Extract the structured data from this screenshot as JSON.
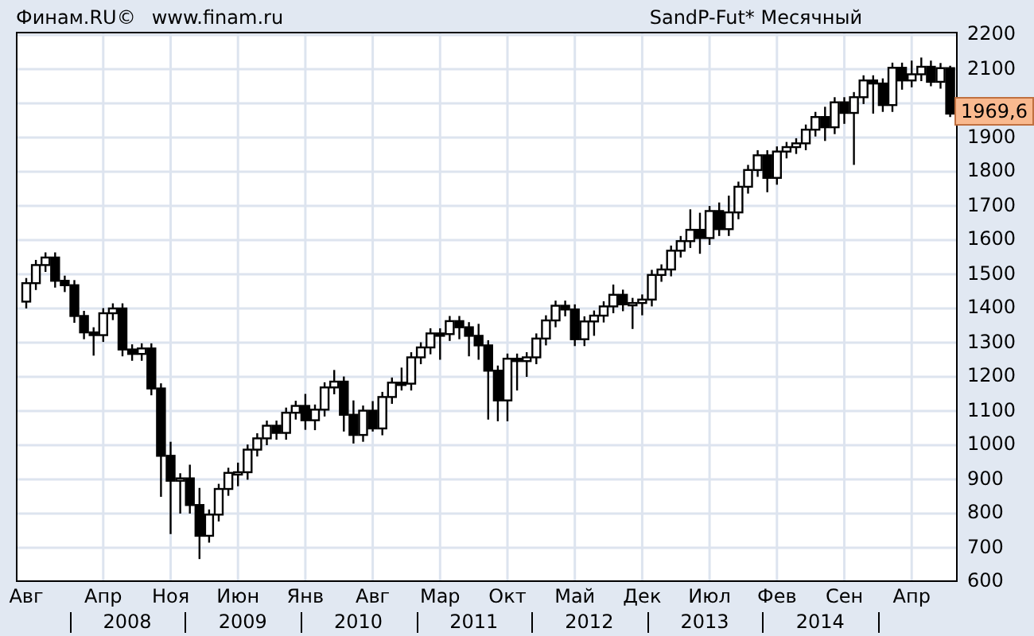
{
  "header": {
    "copyright": "Финам.RU©",
    "site": "www.finam.ru",
    "instrument": "SandP-Fut* Месячный"
  },
  "chart": {
    "chart_data": {
      "type": "candlestick",
      "categories": [
        "Авг",
        null,
        null,
        null,
        null,
        null,
        null,
        null,
        "Апр",
        null,
        null,
        null,
        null,
        null,
        null,
        "Ноя",
        null,
        null,
        null,
        null,
        null,
        null,
        "Июн",
        null,
        null,
        null,
        null,
        null,
        null,
        "Янв",
        null,
        null,
        null,
        null,
        null,
        null,
        "Авг",
        null,
        null,
        null,
        null,
        null,
        null,
        "Мар",
        null,
        null,
        null,
        null,
        null,
        null,
        "Окт",
        null,
        null,
        null,
        null,
        null,
        null,
        "Май",
        null,
        null,
        null,
        null,
        null,
        null,
        "Дек",
        null,
        null,
        null,
        null,
        null,
        null,
        "Июл",
        null,
        null,
        null,
        null,
        null,
        null,
        "Фев",
        null,
        null,
        null,
        null,
        null,
        null,
        "Сен",
        null,
        null,
        null,
        null,
        null,
        null,
        "Апр",
        null,
        null,
        null,
        null
      ],
      "ohlc": [
        [
          1420,
          1489,
          1400,
          1474
        ],
        [
          1474,
          1542,
          1454,
          1527
        ],
        [
          1527,
          1564,
          1507,
          1549
        ],
        [
          1549,
          1564,
          1461,
          1481
        ],
        [
          1481,
          1496,
          1448,
          1468
        ],
        [
          1468,
          1483,
          1358,
          1378
        ],
        [
          1378,
          1393,
          1310,
          1330
        ],
        [
          1330,
          1345,
          1262,
          1322
        ],
        [
          1322,
          1401,
          1302,
          1386
        ],
        [
          1386,
          1415,
          1366,
          1400
        ],
        [
          1400,
          1415,
          1260,
          1280
        ],
        [
          1280,
          1295,
          1247,
          1267
        ],
        [
          1267,
          1298,
          1247,
          1283
        ],
        [
          1283,
          1298,
          1146,
          1166
        ],
        [
          1166,
          1181,
          849,
          969
        ],
        [
          969,
          1010,
          740,
          896
        ],
        [
          896,
          918,
          800,
          903
        ],
        [
          903,
          943,
          800,
          825
        ],
        [
          825,
          875,
          667,
          735
        ],
        [
          735,
          812,
          715,
          797
        ],
        [
          797,
          887,
          777,
          872
        ],
        [
          872,
          934,
          852,
          919
        ],
        [
          919,
          949,
          880,
          921
        ],
        [
          921,
          1002,
          899,
          987
        ],
        [
          987,
          1035,
          967,
          1020
        ],
        [
          1020,
          1072,
          1000,
          1057
        ],
        [
          1057,
          1072,
          1016,
          1036
        ],
        [
          1036,
          1110,
          1016,
          1095
        ],
        [
          1095,
          1130,
          1075,
          1115
        ],
        [
          1115,
          1150,
          1045,
          1073
        ],
        [
          1073,
          1119,
          1044,
          1104
        ],
        [
          1104,
          1184,
          1084,
          1169
        ],
        [
          1169,
          1220,
          1149,
          1186
        ],
        [
          1186,
          1201,
          1040,
          1089
        ],
        [
          1089,
          1131,
          1005,
          1030
        ],
        [
          1030,
          1116,
          1010,
          1101
        ],
        [
          1101,
          1129,
          1040,
          1049
        ],
        [
          1049,
          1156,
          1029,
          1141
        ],
        [
          1141,
          1198,
          1121,
          1183
        ],
        [
          1183,
          1227,
          1160,
          1180
        ],
        [
          1180,
          1272,
          1160,
          1257
        ],
        [
          1257,
          1301,
          1237,
          1286
        ],
        [
          1286,
          1342,
          1266,
          1327
        ],
        [
          1327,
          1342,
          1250,
          1325
        ],
        [
          1325,
          1378,
          1305,
          1363
        ],
        [
          1363,
          1378,
          1310,
          1345
        ],
        [
          1345,
          1360,
          1260,
          1320
        ],
        [
          1320,
          1355,
          1250,
          1292
        ],
        [
          1292,
          1307,
          1075,
          1218
        ],
        [
          1218,
          1233,
          1070,
          1131
        ],
        [
          1131,
          1268,
          1070,
          1253
        ],
        [
          1253,
          1268,
          1160,
          1246
        ],
        [
          1246,
          1272,
          1200,
          1257
        ],
        [
          1257,
          1327,
          1237,
          1312
        ],
        [
          1312,
          1380,
          1292,
          1365
        ],
        [
          1365,
          1423,
          1345,
          1408
        ],
        [
          1408,
          1423,
          1377,
          1397
        ],
        [
          1397,
          1412,
          1290,
          1310
        ],
        [
          1310,
          1377,
          1290,
          1362
        ],
        [
          1362,
          1394,
          1320,
          1379
        ],
        [
          1379,
          1421,
          1359,
          1406
        ],
        [
          1406,
          1470,
          1386,
          1440
        ],
        [
          1440,
          1455,
          1392,
          1412
        ],
        [
          1412,
          1431,
          1340,
          1416
        ],
        [
          1416,
          1441,
          1380,
          1426
        ],
        [
          1426,
          1513,
          1406,
          1498
        ],
        [
          1498,
          1529,
          1478,
          1514
        ],
        [
          1514,
          1584,
          1494,
          1569
        ],
        [
          1569,
          1612,
          1549,
          1597
        ],
        [
          1597,
          1690,
          1577,
          1630
        ],
        [
          1630,
          1680,
          1560,
          1606
        ],
        [
          1606,
          1700,
          1586,
          1685
        ],
        [
          1685,
          1710,
          1612,
          1632
        ],
        [
          1632,
          1730,
          1612,
          1681
        ],
        [
          1681,
          1771,
          1661,
          1756
        ],
        [
          1756,
          1820,
          1736,
          1805
        ],
        [
          1805,
          1863,
          1785,
          1848
        ],
        [
          1848,
          1863,
          1740,
          1782
        ],
        [
          1782,
          1874,
          1762,
          1859
        ],
        [
          1859,
          1887,
          1839,
          1872
        ],
        [
          1872,
          1898,
          1852,
          1883
        ],
        [
          1883,
          1938,
          1863,
          1923
        ],
        [
          1923,
          1975,
          1903,
          1960
        ],
        [
          1960,
          1990,
          1890,
          1930
        ],
        [
          1930,
          2018,
          1910,
          2003
        ],
        [
          2003,
          2018,
          1940,
          1972
        ],
        [
          1972,
          2033,
          1820,
          2018
        ],
        [
          2018,
          2082,
          1998,
          2067
        ],
        [
          2067,
          2082,
          1970,
          2058
        ],
        [
          2058,
          2073,
          1975,
          1995
        ],
        [
          1995,
          2119,
          1975,
          2104
        ],
        [
          2104,
          2119,
          2040,
          2067
        ],
        [
          2067,
          2125,
          2047,
          2085
        ],
        [
          2085,
          2134,
          2065,
          2107
        ],
        [
          2107,
          2125,
          2050,
          2063
        ],
        [
          2063,
          2118,
          2043,
          2103
        ],
        [
          2103,
          2110,
          1960,
          1970
        ]
      ],
      "ylim": [
        600,
        2200
      ],
      "grid": true,
      "yticks": [
        {
          "value": 600,
          "label": "600"
        },
        {
          "value": 700,
          "label": "700"
        },
        {
          "value": 800,
          "label": "800"
        },
        {
          "value": 900,
          "label": "900"
        },
        {
          "value": 1000,
          "label": "1000"
        },
        {
          "value": 1100,
          "label": "1100"
        },
        {
          "value": 1200,
          "label": "1200"
        },
        {
          "value": 1300,
          "label": "1300"
        },
        {
          "value": 1400,
          "label": "1400"
        },
        {
          "value": 1500,
          "label": "1500"
        },
        {
          "value": 1600,
          "label": "1600"
        },
        {
          "value": 1700,
          "label": "1700"
        },
        {
          "value": 1800,
          "label": "1800"
        },
        {
          "value": 1900,
          "label": "1900"
        },
        {
          "value": 2100,
          "label": "2100"
        },
        {
          "value": 2200,
          "label": "2200"
        }
      ]
    },
    "year_labels": [
      "2008",
      "2009",
      "2010",
      "2011",
      "2012",
      "2013",
      "2014"
    ],
    "last_price": "1969,6"
  }
}
